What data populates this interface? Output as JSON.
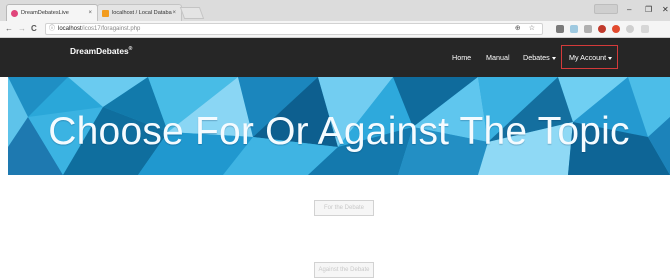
{
  "browser": {
    "tabs": [
      {
        "title": "DreamDebatesLive",
        "close": "×"
      },
      {
        "title": "localhost / Local Databa",
        "close": "×"
      }
    ],
    "user_button": "",
    "window_controls": {
      "minimize": "–",
      "maximize": "❐",
      "close": "✕"
    },
    "nav": {
      "back": "←",
      "forward": "→",
      "reload": "C"
    },
    "url": {
      "host": "localhost",
      "path": "/icos17/foragainst.php"
    },
    "address_icons": "⊕ ☆"
  },
  "site": {
    "brand": "DreamDebates",
    "brand_mark": "®",
    "nav": {
      "home": "Home",
      "manual": "Manual",
      "debates": "Debates",
      "account": "My Account"
    }
  },
  "hero": {
    "title": "Choose For Or Against The Topic"
  },
  "choices": {
    "for_label": "For the Debate",
    "against_label": "Against the Debate"
  },
  "colors": {
    "navbar": "#262626",
    "account_outline": "#d43a3a",
    "hero_base": "#2aa7d9"
  }
}
